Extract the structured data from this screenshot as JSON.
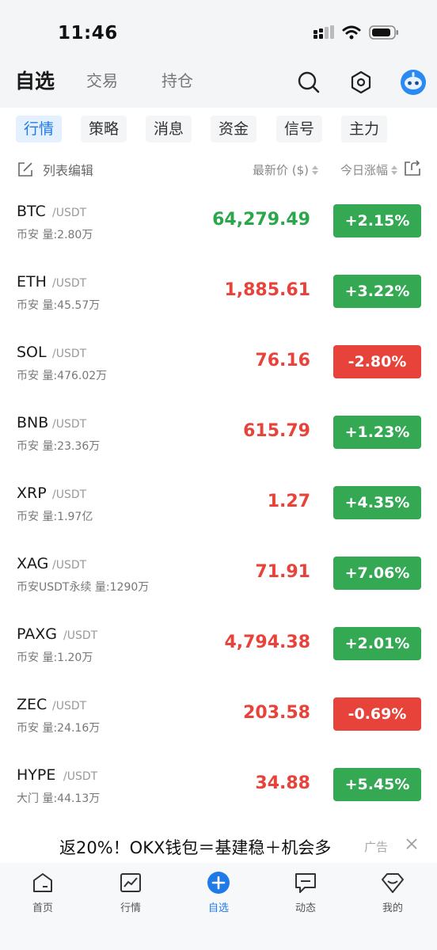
{
  "status": {
    "time": "11:46"
  },
  "top_nav": {
    "tabs": [
      {
        "label": "自选",
        "active": true
      },
      {
        "label": "交易",
        "active": false
      },
      {
        "label": "持仓",
        "active": false
      }
    ],
    "icons": [
      "search-icon",
      "settings-hexagon-icon",
      "robot-avatar-icon"
    ]
  },
  "chips": [
    {
      "label": "行情",
      "active": true
    },
    {
      "label": "策略",
      "active": false
    },
    {
      "label": "消息",
      "active": false
    },
    {
      "label": "资金",
      "active": false
    },
    {
      "label": "信号",
      "active": false
    },
    {
      "label": "主力",
      "active": false
    }
  ],
  "list_header": {
    "edit_label": "列表编辑",
    "price_label": "最新价 ($)",
    "change_label": "今日涨幅"
  },
  "rows": [
    {
      "symbol": "BTC",
      "quote": "/USDT",
      "sub": "币安 量:2.80万",
      "price": "64,279.49",
      "price_dir": "up",
      "change": "+2.15%",
      "change_dir": "pos"
    },
    {
      "symbol": "ETH",
      "quote": "/USDT",
      "sub": "币安 量:45.57万",
      "price": "1,885.61",
      "price_dir": "dn",
      "change": "+3.22%",
      "change_dir": "pos"
    },
    {
      "symbol": "SOL",
      "quote": "/USDT",
      "sub": "币安 量:476.02万",
      "price": "76.16",
      "price_dir": "dn",
      "change": "-2.80%",
      "change_dir": "neg"
    },
    {
      "symbol": "BNB",
      "quote": "/USDT",
      "sub": "币安 量:23.36万",
      "price": "615.79",
      "price_dir": "dn",
      "change": "+1.23%",
      "change_dir": "pos"
    },
    {
      "symbol": "XRP",
      "quote": "/USDT",
      "sub": "币安 量:1.97亿",
      "price": "1.27",
      "price_dir": "dn",
      "change": "+4.35%",
      "change_dir": "pos"
    },
    {
      "symbol": "XAG",
      "quote": "/USDT",
      "sub": "币安USDT永续 量:1290万",
      "price": "71.91",
      "price_dir": "dn",
      "change": "+7.06%",
      "change_dir": "pos"
    },
    {
      "symbol": "PAXG",
      "quote": "/USDT",
      "sub": "币安 量:1.20万",
      "price": "4,794.38",
      "price_dir": "dn",
      "change": "+2.01%",
      "change_dir": "pos"
    },
    {
      "symbol": "ZEC",
      "quote": "/USDT",
      "sub": "币安 量:24.16万",
      "price": "203.58",
      "price_dir": "dn",
      "change": "-0.69%",
      "change_dir": "neg"
    },
    {
      "symbol": "HYPE",
      "quote": "/USDT",
      "sub": "大门 量:44.13万",
      "price": "34.88",
      "price_dir": "dn",
      "change": "+5.45%",
      "change_dir": "pos"
    }
  ],
  "ad": {
    "text": "返20%！OKX钱包＝基建稳＋机会多",
    "label": "广告"
  },
  "bottom_nav": [
    {
      "label": "首页",
      "icon": "home-icon",
      "active": false
    },
    {
      "label": "行情",
      "icon": "chart-icon",
      "active": false
    },
    {
      "label": "自选",
      "icon": "add-circle-icon",
      "active": true
    },
    {
      "label": "动态",
      "icon": "message-icon",
      "active": false
    },
    {
      "label": "我的",
      "icon": "profile-gem-icon",
      "active": false
    }
  ],
  "colors": {
    "accent": "#1f7ae8",
    "up_green": "#34a853",
    "down_red": "#e8433a"
  }
}
